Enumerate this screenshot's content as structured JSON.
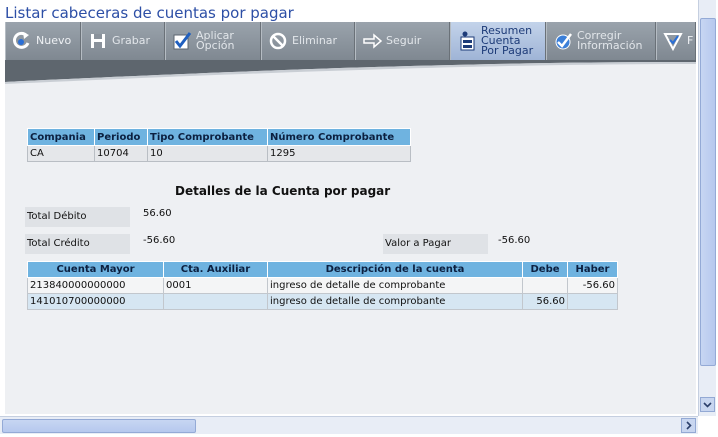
{
  "page_title": "Listar cabeceras de cuentas por pagar",
  "toolbar": [
    {
      "label": "Nuevo",
      "icon": "new-icon",
      "state": "enabled"
    },
    {
      "label": "Grabar",
      "icon": "save-icon",
      "state": "disabled"
    },
    {
      "label": "Aplicar\nOpción",
      "icon": "apply-check-icon",
      "state": "disabled"
    },
    {
      "label": "Eliminar",
      "icon": "delete-icon",
      "state": "disabled"
    },
    {
      "label": "Seguir",
      "icon": "arrow-right-icon",
      "state": "disabled"
    },
    {
      "label": "Resumen\nCuenta\nPor Pagar",
      "icon": "summary-icon",
      "state": "active"
    },
    {
      "label": "Corregir\nInformación",
      "icon": "correct-check-icon",
      "state": "disabled"
    },
    {
      "label": "F",
      "icon": "filter-icon",
      "state": "enabled"
    }
  ],
  "header_table": {
    "columns": [
      "Compania",
      "Periodo",
      "Tipo Comprobante",
      "Número Comprobante"
    ],
    "row": [
      "CA",
      "10704",
      "10",
      "1295"
    ]
  },
  "details": {
    "title": "Detalles de la Cuenta por pagar",
    "total_debito_label": "Total Débito",
    "total_debito_value": "56.60",
    "total_credito_label": "Total Crédito",
    "total_credito_value": "-56.60",
    "valor_pagar_label": "Valor a Pagar",
    "valor_pagar_value": "-56.60"
  },
  "detail_table": {
    "columns": [
      "Cuenta Mayor",
      "Cta. Auxiliar",
      "Descripción de la cuenta",
      "Debe",
      "Haber"
    ],
    "rows": [
      [
        "213840000000000",
        "0001",
        "ingreso de detalle de comprobante",
        "",
        "-56.60"
      ],
      [
        "141010700000000",
        "",
        "ingreso de detalle de comprobante",
        "56.60",
        ""
      ]
    ]
  },
  "colors": {
    "title": "#2d4fa6",
    "toolbar": "#8a929b",
    "table_header": "#6fb3e0",
    "content_bg": "#eef0f3"
  }
}
